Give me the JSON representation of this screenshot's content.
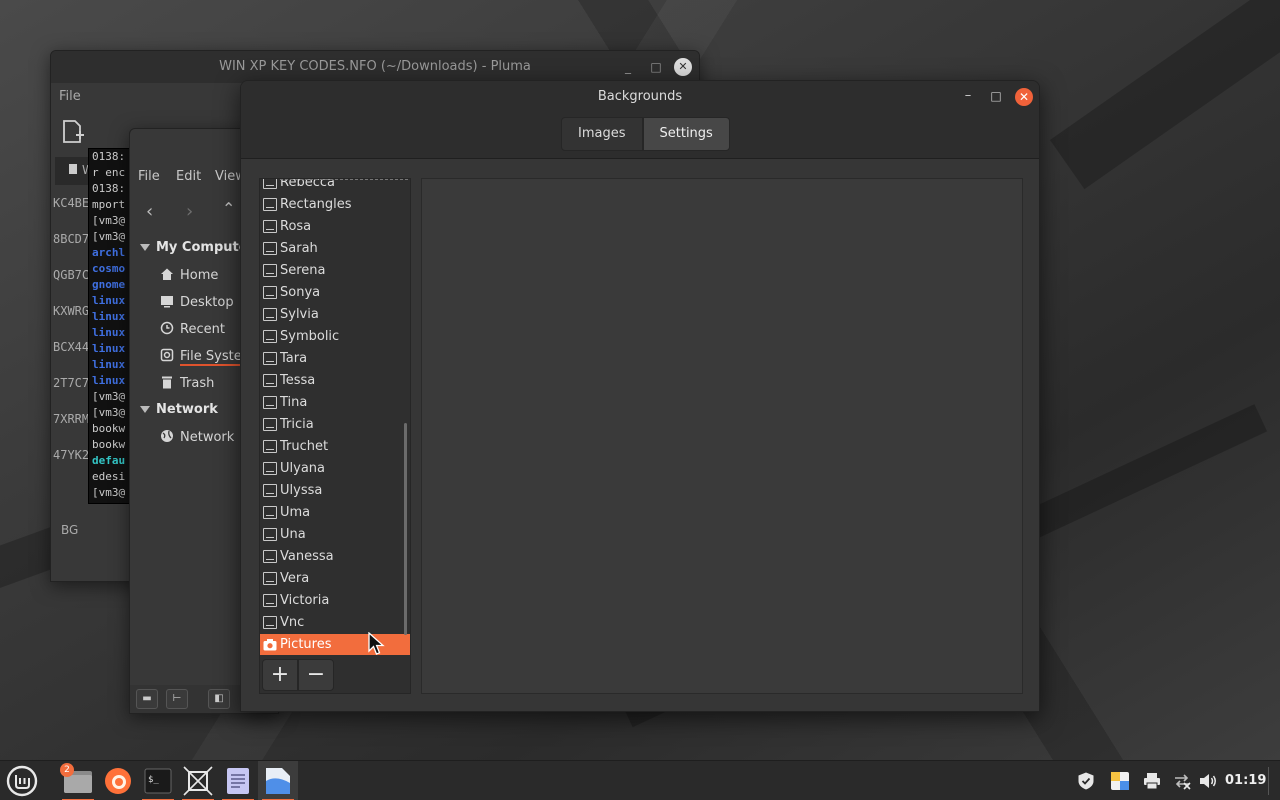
{
  "pluma": {
    "title": "WIN XP KEY CODES.NFO (~/Downloads) - Pluma",
    "menu_file": "File",
    "doc_tab": "W",
    "key_lines": [
      "KC4BE",
      "8BCD7",
      "QGB7C",
      "KXWRG",
      "BCX44",
      "2T7C7",
      "7XRRM",
      "47YK2"
    ],
    "bottom_label": "BG"
  },
  "terminal": {
    "lines": [
      {
        "text": "0138:",
        "color": "normal"
      },
      {
        "text": "r enc",
        "color": "normal"
      },
      {
        "text": "0138:",
        "color": "normal"
      },
      {
        "text": "mport",
        "color": "normal"
      },
      {
        "text": "[vm3@",
        "color": "normal"
      },
      {
        "text": "[vm3@",
        "color": "normal"
      },
      {
        "text": "archl",
        "color": "blue"
      },
      {
        "text": "cosmo",
        "color": "blue"
      },
      {
        "text": "gnome",
        "color": "blue"
      },
      {
        "text": "linux",
        "color": "blue"
      },
      {
        "text": "linux",
        "color": "blue"
      },
      {
        "text": "linux",
        "color": "blue"
      },
      {
        "text": "linux",
        "color": "blue"
      },
      {
        "text": "linux",
        "color": "blue"
      },
      {
        "text": "linux",
        "color": "blue"
      },
      {
        "text": "[vm3@",
        "color": "normal"
      },
      {
        "text": "[vm3@",
        "color": "normal"
      },
      {
        "text": "bookw",
        "color": "normal"
      },
      {
        "text": "bookw",
        "color": "normal"
      },
      {
        "text": "defau",
        "color": "cyan"
      },
      {
        "text": "edesi",
        "color": "normal"
      },
      {
        "text": "[vm3@",
        "color": "normal"
      }
    ]
  },
  "nemo": {
    "menu_file": "File",
    "menu_edit": "Edit",
    "menu_view": "View",
    "section_computer": "My Computer",
    "places": {
      "home": "Home",
      "desktop": "Desktop",
      "recent": "Recent",
      "filesystem": "File System",
      "trash": "Trash"
    },
    "section_network": "Network",
    "network_item": "Network"
  },
  "backgrounds": {
    "title": "Backgrounds",
    "tabs": {
      "images": "Images",
      "settings": "Settings"
    },
    "folders": [
      "Rebecca",
      "Rectangles",
      "Rosa",
      "Sarah",
      "Serena",
      "Sonya",
      "Sylvia",
      "Symbolic",
      "Tara",
      "Tessa",
      "Tina",
      "Tricia",
      "Truchet",
      "Ulyana",
      "Ulyssa",
      "Uma",
      "Una",
      "Vanessa",
      "Vera",
      "Victoria",
      "Vnc"
    ],
    "selected_folder": "Pictures",
    "add_label": "+",
    "remove_label": "−"
  },
  "panel": {
    "badge_count": "2",
    "clock": "01:19"
  },
  "colors": {
    "accent": "#f26d3d",
    "close_button": "#f0623a"
  }
}
